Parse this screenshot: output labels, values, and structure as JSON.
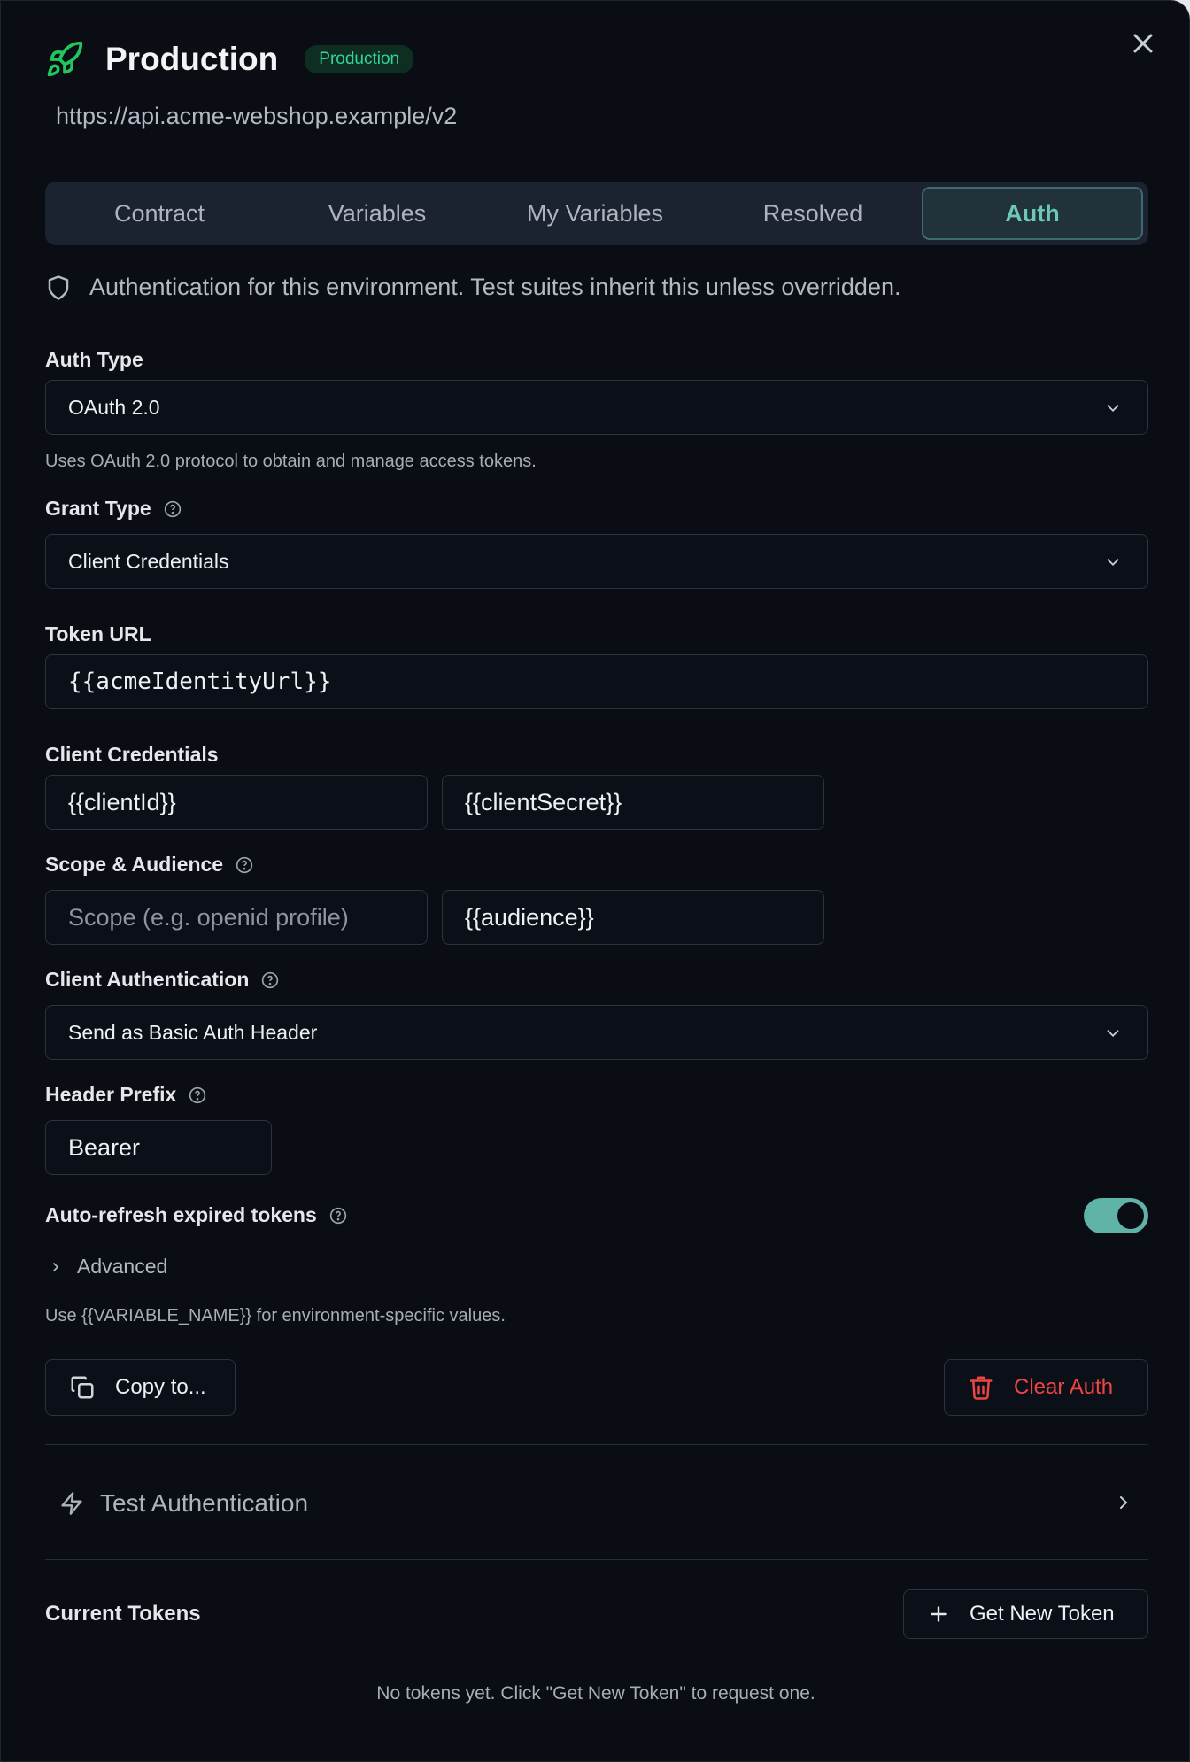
{
  "header": {
    "title": "Production",
    "badge": "Production",
    "url": "https://api.acme-webshop.example/v2",
    "colors": {
      "accent": "#34d399",
      "teal": "#6cc9ba",
      "danger": "#ef4444"
    }
  },
  "tabs": [
    {
      "label": "Contract",
      "active": false
    },
    {
      "label": "Variables",
      "active": false
    },
    {
      "label": "My Variables",
      "active": false
    },
    {
      "label": "Resolved",
      "active": false
    },
    {
      "label": "Auth",
      "active": true
    }
  ],
  "info_text": "Authentication for this environment. Test suites inherit this unless overridden.",
  "auth_type": {
    "label": "Auth Type",
    "value": "OAuth 2.0",
    "hint": "Uses OAuth 2.0 protocol to obtain and manage access tokens."
  },
  "grant_type": {
    "label": "Grant Type",
    "value": "Client Credentials"
  },
  "token_url": {
    "label": "Token URL",
    "value": "{{acmeIdentityUrl}}"
  },
  "client_credentials": {
    "label": "Client Credentials",
    "client_id": "{{clientId}}",
    "client_secret": "{{clientSecret}}"
  },
  "scope_audience": {
    "label": "Scope & Audience",
    "scope_placeholder": "Scope (e.g. openid profile)",
    "audience": "{{audience}}"
  },
  "client_auth": {
    "label": "Client Authentication",
    "value": "Send as Basic Auth Header"
  },
  "header_prefix": {
    "label": "Header Prefix",
    "value": "Bearer"
  },
  "auto_refresh": {
    "label": "Auto-refresh expired tokens",
    "enabled": true
  },
  "advanced_label": "Advanced",
  "variable_hint": "Use {{VARIABLE_NAME}} for environment-specific values.",
  "actions": {
    "copy_label": "Copy to...",
    "clear_label": "Clear Auth"
  },
  "test_auth_label": "Test Authentication",
  "tokens": {
    "title": "Current Tokens",
    "new_token_label": "Get New Token",
    "empty_text": "No tokens yet. Click \"Get New Token\" to request one."
  }
}
